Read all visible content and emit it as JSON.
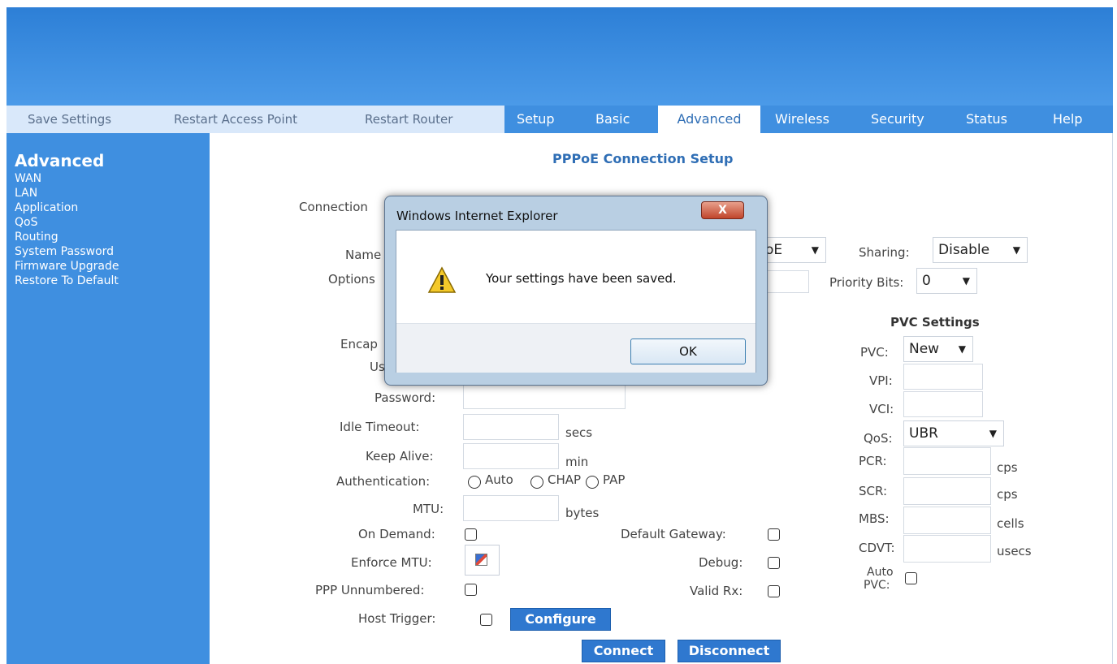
{
  "nav": {
    "util": [
      "Save Settings",
      "Restart Access Point",
      "Restart Router"
    ],
    "tabs": [
      "Setup",
      "Basic",
      "Advanced",
      "Wireless",
      "Security",
      "Status",
      "Help"
    ],
    "active_tab": "Advanced"
  },
  "sidebar": {
    "title": "Advanced",
    "items": [
      "WAN",
      "LAN",
      "Application",
      "QoS",
      "Routing",
      "System Password",
      "Firmware Upgrade",
      "Restore To Default"
    ]
  },
  "main": {
    "heading": "PPPoE Connection Setup",
    "labels": {
      "connection": "Connection",
      "name": "Name",
      "options": "Options",
      "encap": "Encap",
      "username": "Us",
      "password": "Password:",
      "idle_timeout": "Idle Timeout:",
      "keep_alive": "Keep Alive:",
      "authentication": "Authentication:",
      "mtu": "MTU:",
      "on_demand": "On Demand:",
      "enforce_mtu": "Enforce MTU:",
      "ppp_unnumbered": "PPP Unnumbered:",
      "host_trigger": "Host Trigger:",
      "default_gateway": "Default Gateway:",
      "debug": "Debug:",
      "valid_rx": "Valid Rx:",
      "sharing": "Sharing:",
      "priority_bits": "Priority Bits:"
    },
    "units": {
      "secs": "secs",
      "min": "min",
      "bytes": "bytes"
    },
    "auth_options": [
      "Auto",
      "CHAP",
      "PAP"
    ],
    "protocol_select_visible": "oE",
    "sharing_value": "Disable",
    "priority_value": "0",
    "buttons": {
      "configure": "Configure",
      "connect": "Connect",
      "disconnect": "Disconnect"
    }
  },
  "pvc": {
    "heading": "PVC Settings",
    "labels": {
      "pvc": "PVC:",
      "vpi": "VPI:",
      "vci": "VCI:",
      "qos": "QoS:",
      "pcr": "PCR:",
      "scr": "SCR:",
      "mbs": "MBS:",
      "cdvt": "CDVT:",
      "auto_pvc_1": "Auto",
      "auto_pvc_2": "PVC:"
    },
    "pvc_value": "New",
    "qos_value": "UBR",
    "units": {
      "pcr": "cps",
      "scr": "cps",
      "mbs": "cells",
      "cdvt": "usecs"
    }
  },
  "dialog": {
    "title": "Windows Internet Explorer",
    "message": "Your settings have been saved.",
    "ok_label": "OK",
    "close_glyph": "X"
  }
}
